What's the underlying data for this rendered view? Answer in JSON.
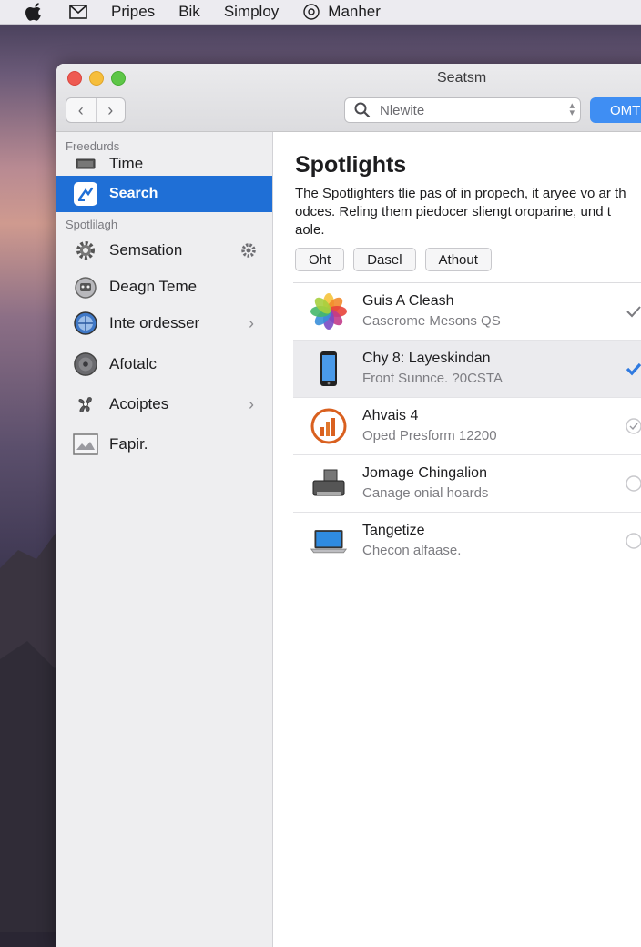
{
  "menubar": {
    "items": [
      "Pripes",
      "Bik",
      "Simploy",
      "Manher"
    ]
  },
  "window": {
    "title": "Seatsm",
    "search": {
      "value": "Nlewite"
    },
    "primary_button": "OMT"
  },
  "sidebar": {
    "section1": "Freedurds",
    "section2": "Spotlilagh",
    "items": [
      {
        "label": "Time",
        "icon": "drive-icon"
      },
      {
        "label": "Search",
        "icon": "search-app-icon",
        "selected": true
      },
      {
        "label": "Semsation",
        "icon": "gear-icon"
      },
      {
        "label": "Deagn Teme",
        "icon": "robot-icon"
      },
      {
        "label": "Inte ordesser",
        "icon": "globe-icon"
      },
      {
        "label": "Afotalc",
        "icon": "disc-icon"
      },
      {
        "label": "Acoiptes",
        "icon": "fan-icon"
      },
      {
        "label": "Fapir.",
        "icon": "image-icon"
      }
    ]
  },
  "main": {
    "heading": "Spotlights",
    "description": "The Spotlighters tlie pas of in propech, it aryee vo ar th\nodces. Reling them piedocer sliengt oroparine, und t\naole.",
    "buttons": [
      "Oht",
      "Dasel",
      "Athout"
    ],
    "list": [
      {
        "title": "Guis A Cleash",
        "subtitle": "Caserome Mesons QS",
        "icon": "photos-icon",
        "status": "check"
      },
      {
        "title": "Chy 8: Layeskindan",
        "subtitle": "Front Sunnce. ?0CSTA",
        "icon": "phone-icon",
        "status": "blue-check",
        "selected": true
      },
      {
        "title": "Ahvais 4",
        "subtitle": "Oped Presform 12200",
        "icon": "chart-icon",
        "status": "circle-check"
      },
      {
        "title": "Jomage Chingalion",
        "subtitle": "Canage onial hoards",
        "icon": "printer-icon",
        "status": "empty"
      },
      {
        "title": "Tangetize",
        "subtitle": "Checon alfaase.",
        "icon": "laptop-icon",
        "status": "empty"
      }
    ]
  },
  "colors": {
    "accent": "#1f6fd6",
    "button_blue": "#3f8ef3"
  }
}
